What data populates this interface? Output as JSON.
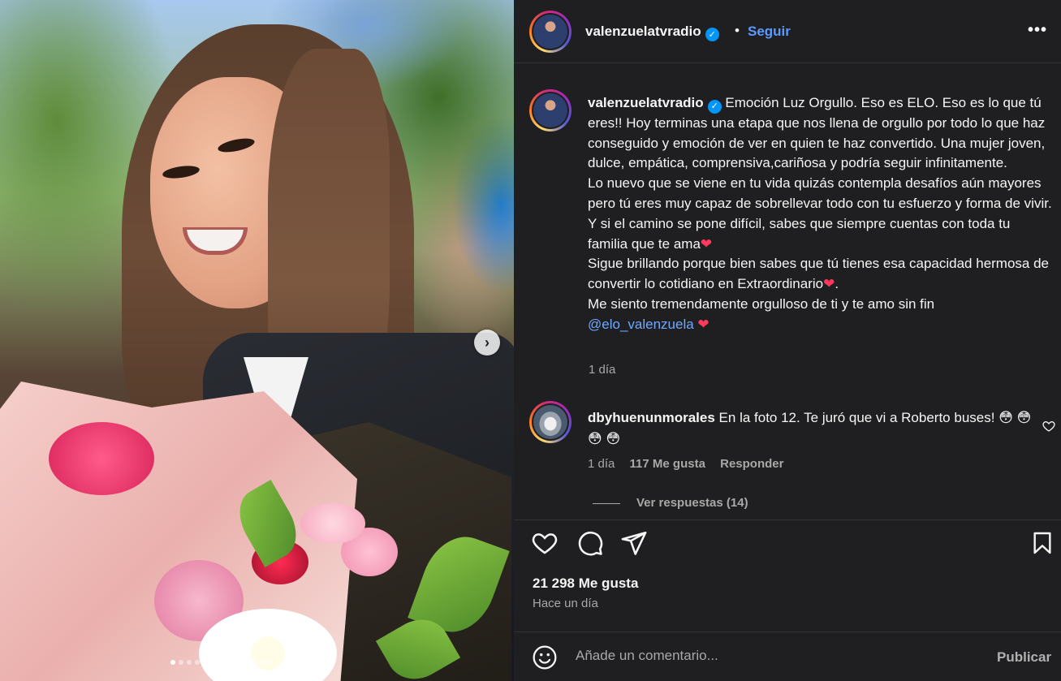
{
  "post": {
    "username": "valenzuelatvradio",
    "verified_badge": "✓",
    "separator": "•",
    "follow_label": "Seguir",
    "more_label": "•••"
  },
  "caption": {
    "username": "valenzuelatvradio",
    "p1": "Emoción Luz Orgullo. Eso es ELO. Eso es lo que tú eres!! Hoy terminas una etapa que nos llena de orgullo por todo lo que haz conseguido y emoción de ver en quien te haz convertido. Una mujer joven, dulce, empática, comprensiva,cariñosa y podría seguir infinitamente.",
    "p2": "Lo nuevo que se viene en tu vida quizás contempla desafíos aún mayores pero tú eres muy capaz de sobrellevar todo con tu esfuerzo y forma de vivir. Y si el camino se pone difícil, sabes que siempre cuentas con toda tu familia que te ama",
    "p3": "Sigue brillando porque bien sabes que tú tienes esa capacidad hermosa de convertir lo cotidiano en Extraordinario",
    "p3_end": ".",
    "p4": "Me siento tremendamente orgulloso de ti y te amo sin fin",
    "mention": "@elo_valenzuela",
    "heart": "❤",
    "time": "1 día"
  },
  "comment": {
    "username": "dbyhuenunmorales",
    "text": "En la foto 12. Te juró que vi a Roberto buses!",
    "emojis": "😳 😳 😳 😳",
    "time": "1 día",
    "likes": "117 Me gusta",
    "reply_label": "Responder",
    "view_replies": "Ver respuestas (14)"
  },
  "stats": {
    "likes": "21 298 Me gusta",
    "posted": "Hace un día"
  },
  "composer": {
    "placeholder": "Añade un comentario...",
    "publish_label": "Publicar"
  },
  "carousel": {
    "next_label": "›",
    "dot_count": 13,
    "active_index": 0
  },
  "icons": {
    "like": "heart-icon",
    "comment": "comment-icon",
    "share": "share-icon",
    "save": "bookmark-icon",
    "emoji": "emoji-icon"
  },
  "colors": {
    "accent": "#0095f6",
    "link": "#5b9bff",
    "panel": "#1f1f21",
    "heart": "#ff3a5c"
  }
}
